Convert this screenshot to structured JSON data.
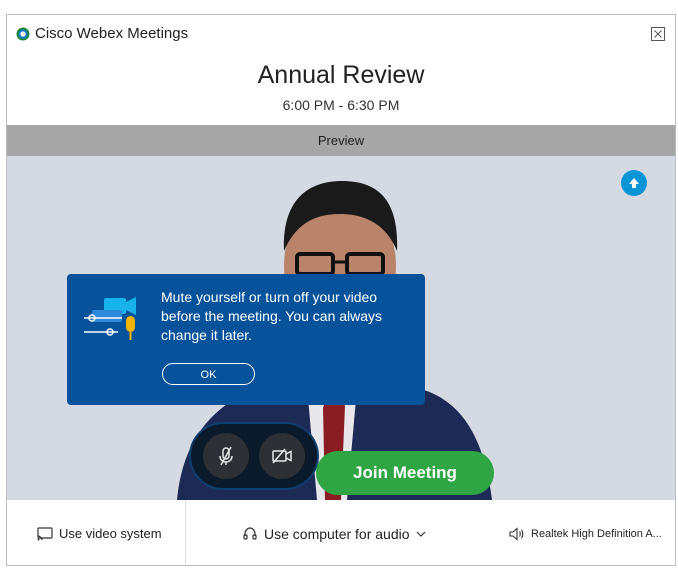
{
  "window": {
    "app_title": "Cisco Webex Meetings"
  },
  "meeting": {
    "title": "Annual Review",
    "time": "6:00 PM - 6:30 PM"
  },
  "preview": {
    "label": "Preview"
  },
  "tooltip": {
    "message": "Mute yourself or turn off your video before the meeting. You can always change it later.",
    "ok_label": "OK"
  },
  "controls": {
    "mic_icon": "mic-muted-icon",
    "video_icon": "video-off-icon",
    "join_label": "Join Meeting"
  },
  "bottom_bar": {
    "video_system_label": "Use video system",
    "audio_label": "Use computer for audio",
    "speaker_label": "Realtek High Definition A..."
  },
  "colors": {
    "accent_blue": "#07539b",
    "join_green": "#2fa544",
    "preview_bar": "#a6a6a6",
    "share_blue": "#0c95d6"
  }
}
